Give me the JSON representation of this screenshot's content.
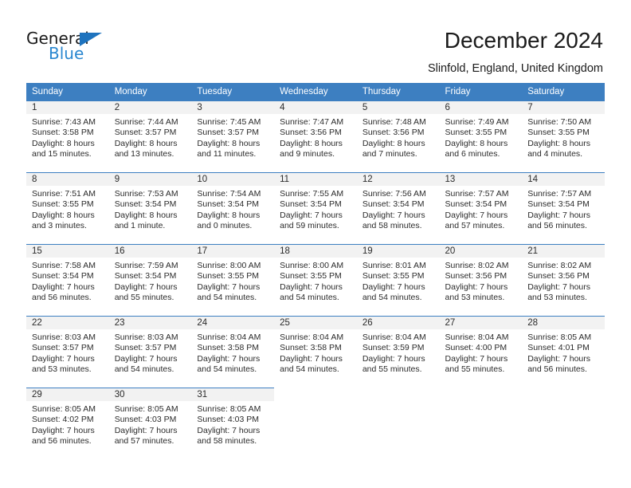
{
  "brand": {
    "name_part1": "General",
    "name_part2": "Blue",
    "triangle_color": "#1e73be",
    "blue_color": "#2a87d0"
  },
  "header": {
    "title": "December 2024",
    "location": "Slinfold, England, United Kingdom"
  },
  "theme": {
    "header_row_bg": "#3d7fc1",
    "daynum_bg": "#f2f2f2",
    "text_color": "#2b2b2b"
  },
  "weekdays": [
    "Sunday",
    "Monday",
    "Tuesday",
    "Wednesday",
    "Thursday",
    "Friday",
    "Saturday"
  ],
  "labels": {
    "sunrise_prefix": "Sunrise:",
    "sunset_prefix": "Sunset:",
    "daylight_prefix": "Daylight:"
  },
  "weeks": [
    [
      {
        "day": "1",
        "sunrise": "Sunrise: 7:43 AM",
        "sunset": "Sunset: 3:58 PM",
        "daylight_line1": "Daylight: 8 hours",
        "daylight_line2": "and 15 minutes."
      },
      {
        "day": "2",
        "sunrise": "Sunrise: 7:44 AM",
        "sunset": "Sunset: 3:57 PM",
        "daylight_line1": "Daylight: 8 hours",
        "daylight_line2": "and 13 minutes."
      },
      {
        "day": "3",
        "sunrise": "Sunrise: 7:45 AM",
        "sunset": "Sunset: 3:57 PM",
        "daylight_line1": "Daylight: 8 hours",
        "daylight_line2": "and 11 minutes."
      },
      {
        "day": "4",
        "sunrise": "Sunrise: 7:47 AM",
        "sunset": "Sunset: 3:56 PM",
        "daylight_line1": "Daylight: 8 hours",
        "daylight_line2": "and 9 minutes."
      },
      {
        "day": "5",
        "sunrise": "Sunrise: 7:48 AM",
        "sunset": "Sunset: 3:56 PM",
        "daylight_line1": "Daylight: 8 hours",
        "daylight_line2": "and 7 minutes."
      },
      {
        "day": "6",
        "sunrise": "Sunrise: 7:49 AM",
        "sunset": "Sunset: 3:55 PM",
        "daylight_line1": "Daylight: 8 hours",
        "daylight_line2": "and 6 minutes."
      },
      {
        "day": "7",
        "sunrise": "Sunrise: 7:50 AM",
        "sunset": "Sunset: 3:55 PM",
        "daylight_line1": "Daylight: 8 hours",
        "daylight_line2": "and 4 minutes."
      }
    ],
    [
      {
        "day": "8",
        "sunrise": "Sunrise: 7:51 AM",
        "sunset": "Sunset: 3:55 PM",
        "daylight_line1": "Daylight: 8 hours",
        "daylight_line2": "and 3 minutes."
      },
      {
        "day": "9",
        "sunrise": "Sunrise: 7:53 AM",
        "sunset": "Sunset: 3:54 PM",
        "daylight_line1": "Daylight: 8 hours",
        "daylight_line2": "and 1 minute."
      },
      {
        "day": "10",
        "sunrise": "Sunrise: 7:54 AM",
        "sunset": "Sunset: 3:54 PM",
        "daylight_line1": "Daylight: 8 hours",
        "daylight_line2": "and 0 minutes."
      },
      {
        "day": "11",
        "sunrise": "Sunrise: 7:55 AM",
        "sunset": "Sunset: 3:54 PM",
        "daylight_line1": "Daylight: 7 hours",
        "daylight_line2": "and 59 minutes."
      },
      {
        "day": "12",
        "sunrise": "Sunrise: 7:56 AM",
        "sunset": "Sunset: 3:54 PM",
        "daylight_line1": "Daylight: 7 hours",
        "daylight_line2": "and 58 minutes."
      },
      {
        "day": "13",
        "sunrise": "Sunrise: 7:57 AM",
        "sunset": "Sunset: 3:54 PM",
        "daylight_line1": "Daylight: 7 hours",
        "daylight_line2": "and 57 minutes."
      },
      {
        "day": "14",
        "sunrise": "Sunrise: 7:57 AM",
        "sunset": "Sunset: 3:54 PM",
        "daylight_line1": "Daylight: 7 hours",
        "daylight_line2": "and 56 minutes."
      }
    ],
    [
      {
        "day": "15",
        "sunrise": "Sunrise: 7:58 AM",
        "sunset": "Sunset: 3:54 PM",
        "daylight_line1": "Daylight: 7 hours",
        "daylight_line2": "and 56 minutes."
      },
      {
        "day": "16",
        "sunrise": "Sunrise: 7:59 AM",
        "sunset": "Sunset: 3:54 PM",
        "daylight_line1": "Daylight: 7 hours",
        "daylight_line2": "and 55 minutes."
      },
      {
        "day": "17",
        "sunrise": "Sunrise: 8:00 AM",
        "sunset": "Sunset: 3:55 PM",
        "daylight_line1": "Daylight: 7 hours",
        "daylight_line2": "and 54 minutes."
      },
      {
        "day": "18",
        "sunrise": "Sunrise: 8:00 AM",
        "sunset": "Sunset: 3:55 PM",
        "daylight_line1": "Daylight: 7 hours",
        "daylight_line2": "and 54 minutes."
      },
      {
        "day": "19",
        "sunrise": "Sunrise: 8:01 AM",
        "sunset": "Sunset: 3:55 PM",
        "daylight_line1": "Daylight: 7 hours",
        "daylight_line2": "and 54 minutes."
      },
      {
        "day": "20",
        "sunrise": "Sunrise: 8:02 AM",
        "sunset": "Sunset: 3:56 PM",
        "daylight_line1": "Daylight: 7 hours",
        "daylight_line2": "and 53 minutes."
      },
      {
        "day": "21",
        "sunrise": "Sunrise: 8:02 AM",
        "sunset": "Sunset: 3:56 PM",
        "daylight_line1": "Daylight: 7 hours",
        "daylight_line2": "and 53 minutes."
      }
    ],
    [
      {
        "day": "22",
        "sunrise": "Sunrise: 8:03 AM",
        "sunset": "Sunset: 3:57 PM",
        "daylight_line1": "Daylight: 7 hours",
        "daylight_line2": "and 53 minutes."
      },
      {
        "day": "23",
        "sunrise": "Sunrise: 8:03 AM",
        "sunset": "Sunset: 3:57 PM",
        "daylight_line1": "Daylight: 7 hours",
        "daylight_line2": "and 54 minutes."
      },
      {
        "day": "24",
        "sunrise": "Sunrise: 8:04 AM",
        "sunset": "Sunset: 3:58 PM",
        "daylight_line1": "Daylight: 7 hours",
        "daylight_line2": "and 54 minutes."
      },
      {
        "day": "25",
        "sunrise": "Sunrise: 8:04 AM",
        "sunset": "Sunset: 3:58 PM",
        "daylight_line1": "Daylight: 7 hours",
        "daylight_line2": "and 54 minutes."
      },
      {
        "day": "26",
        "sunrise": "Sunrise: 8:04 AM",
        "sunset": "Sunset: 3:59 PM",
        "daylight_line1": "Daylight: 7 hours",
        "daylight_line2": "and 55 minutes."
      },
      {
        "day": "27",
        "sunrise": "Sunrise: 8:04 AM",
        "sunset": "Sunset: 4:00 PM",
        "daylight_line1": "Daylight: 7 hours",
        "daylight_line2": "and 55 minutes."
      },
      {
        "day": "28",
        "sunrise": "Sunrise: 8:05 AM",
        "sunset": "Sunset: 4:01 PM",
        "daylight_line1": "Daylight: 7 hours",
        "daylight_line2": "and 56 minutes."
      }
    ],
    [
      {
        "day": "29",
        "sunrise": "Sunrise: 8:05 AM",
        "sunset": "Sunset: 4:02 PM",
        "daylight_line1": "Daylight: 7 hours",
        "daylight_line2": "and 56 minutes."
      },
      {
        "day": "30",
        "sunrise": "Sunrise: 8:05 AM",
        "sunset": "Sunset: 4:03 PM",
        "daylight_line1": "Daylight: 7 hours",
        "daylight_line2": "and 57 minutes."
      },
      {
        "day": "31",
        "sunrise": "Sunrise: 8:05 AM",
        "sunset": "Sunset: 4:03 PM",
        "daylight_line1": "Daylight: 7 hours",
        "daylight_line2": "and 58 minutes."
      },
      null,
      null,
      null,
      null
    ]
  ]
}
